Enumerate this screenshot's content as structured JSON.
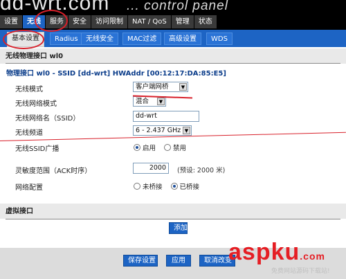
{
  "logo": {
    "brand": "dd-wrt.com",
    "tagline": "... control panel"
  },
  "main_tabs": [
    "设置",
    "无线",
    "服务",
    "安全",
    "访问限制",
    "NAT / QoS",
    "管理",
    "状态"
  ],
  "sub_tabs": [
    "基本设置",
    "Radius",
    "无线安全",
    "MAC过滤",
    "高级设置",
    "WDS"
  ],
  "section_physical": "无线物理接口 wl0",
  "interface_line": "物理接口 wl0 - SSID [dd-wrt] HWAddr [00:12:17:DA:85:E5]",
  "fields": {
    "mode": {
      "label": "无线模式",
      "value": "客户端网桥"
    },
    "network_mode": {
      "label": "无线网络模式",
      "value": "混合"
    },
    "ssid": {
      "label": "无线网络名（SSID）",
      "value": "dd-wrt"
    },
    "channel": {
      "label": "无线频道",
      "value": "6 - 2.437 GHz"
    },
    "ssid_broadcast": {
      "label": "无线SSID广播",
      "options": [
        "启用",
        "禁用"
      ],
      "selected": "启用"
    },
    "ack": {
      "label": "灵敏度范围（ACK时序）",
      "value": "2000",
      "hint": "(预设: 2000 米)"
    },
    "net_config": {
      "label": "网络配置",
      "options": [
        "未桥接",
        "已桥接"
      ],
      "selected": "已桥接"
    }
  },
  "section_virtual": "虚拟接口",
  "buttons": {
    "add": "添加",
    "save": "保存设置",
    "apply": "应用",
    "cancel": "取消改变"
  },
  "watermark": {
    "brand": "aspku",
    "suffix": ".com",
    "subtitle": "免费网站源码下载站!"
  },
  "colors": {
    "accent_blue": "#1d64c4",
    "annotation_red": "#d8202a",
    "watermark_red": "#e51e24"
  }
}
